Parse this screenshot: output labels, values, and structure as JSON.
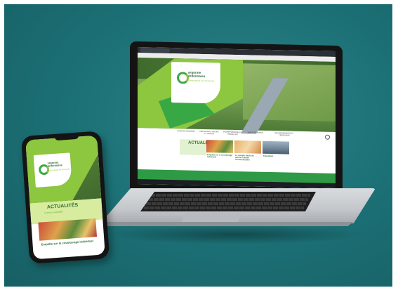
{
  "site": {
    "logo_title_line1": "argonne",
    "logo_title_line2": "ardennaise",
    "logo_subtitle": "communauté de communes",
    "nav_items": [
      "VIVRE EN ARGONNE",
      "DÉCOUVRIR, VISITER ET SORTIR",
      "ENTREPRENDRE ET TRAVAILLER",
      "SANTÉ ET SOCIAL",
      "ENVIRONNEMENT ET TERRITOIRE"
    ],
    "news_heading": "ACTUALITÉS",
    "news_cards": [
      {
        "text": "Enquête sur le covoiturage individuel"
      },
      {
        "text": "Le compte rendu du dernier conseil communautaire"
      },
      {
        "text": "Exposition"
      }
    ]
  },
  "phone": {
    "news_heading": "ACTUALITÉS",
    "news_subheading": "toutes les actualités",
    "caption": "Enquête sur le covoiturage individuel"
  },
  "colors": {
    "background": "#1b6f74",
    "brand_green": "#2c6f35",
    "lime": "#8dc63f",
    "green": "#38a845"
  }
}
